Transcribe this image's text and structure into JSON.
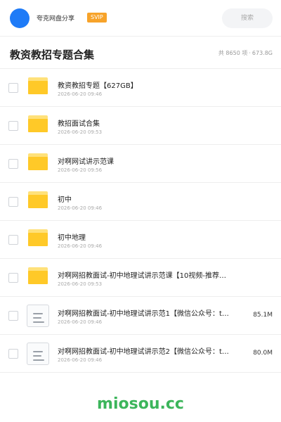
{
  "header": {
    "user_name": "夸克网盘分享",
    "badge": "SVIP",
    "search_label": "搜索"
  },
  "folder": {
    "title": "教资教招专题合集",
    "item_count": "共 8650 项",
    "separator": "·",
    "total_size": "673.8G"
  },
  "files": [
    {
      "type": "folder",
      "name": "教资教招专题【627GB】",
      "date": "2026-06-20 09:46",
      "size": ""
    },
    {
      "type": "folder",
      "name": "教招面试合集",
      "date": "2026-06-20 09:53",
      "size": ""
    },
    {
      "type": "folder",
      "name": "对啊网试讲示范课",
      "date": "2026-06-20 09:56",
      "size": ""
    },
    {
      "type": "folder",
      "name": "初中",
      "date": "2026-06-20 09:46",
      "size": ""
    },
    {
      "type": "folder",
      "name": "初中地理",
      "date": "2026-06-20 09:46",
      "size": ""
    },
    {
      "type": "folder",
      "name": "对啊网招教面试-初中地理试讲示范课【10视频-推荐…",
      "date": "2026-06-20 09:53",
      "size": ""
    },
    {
      "type": "doc",
      "name": "对啊网招教面试-初中地理试讲示范1【微信公众号：t…",
      "date": "2026-06-20 09:46",
      "size": "85.1M"
    },
    {
      "type": "doc",
      "name": "对啊网招教面试-初中地理试讲示范2【微信公众号：t…",
      "date": "2026-06-20 09:46",
      "size": "80.0M"
    }
  ],
  "watermark": "miosou.cc"
}
